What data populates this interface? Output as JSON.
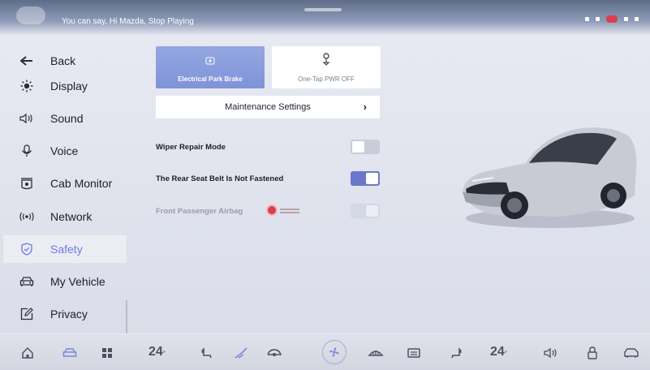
{
  "status_bar": {
    "voice_hint": "You can say, Hi Mazda, Stop Playing"
  },
  "sidebar": {
    "items": [
      {
        "label": "Back",
        "icon": "back-arrow-icon",
        "active": false
      },
      {
        "label": "Display",
        "icon": "sun-icon",
        "active": false
      },
      {
        "label": "Sound",
        "icon": "speaker-icon",
        "active": false
      },
      {
        "label": "Voice",
        "icon": "microphone-icon",
        "active": false
      },
      {
        "label": "Cab Monitor",
        "icon": "camera-icon",
        "active": false
      },
      {
        "label": "Network",
        "icon": "network-icon",
        "active": false
      },
      {
        "label": "Safety",
        "icon": "shield-icon",
        "active": true
      },
      {
        "label": "My Vehicle",
        "icon": "car-icon",
        "active": false
      },
      {
        "label": "Privacy",
        "icon": "edit-icon",
        "active": false
      }
    ]
  },
  "main": {
    "cards": [
      {
        "label": "Electrical Park Brake",
        "selected": true
      },
      {
        "label": "One-Tap PWR OFF",
        "selected": false
      }
    ],
    "maintenance_label": "Maintenance Settings",
    "options": [
      {
        "label": "Wiper Repair Mode",
        "state": "off"
      },
      {
        "label": "The Rear Seat Belt Is Not Fastened",
        "state": "on"
      },
      {
        "label": "Front Passenger Airbag",
        "state": "disabled-on"
      }
    ]
  },
  "dock": {
    "temp_left": "24",
    "temp_right": "24",
    "temp_unit": "°"
  },
  "colors": {
    "accent": "#6f78e8",
    "selected_card": "#8799dd",
    "toggle_on": "#6a78cc",
    "alert_red": "#d8404d"
  }
}
